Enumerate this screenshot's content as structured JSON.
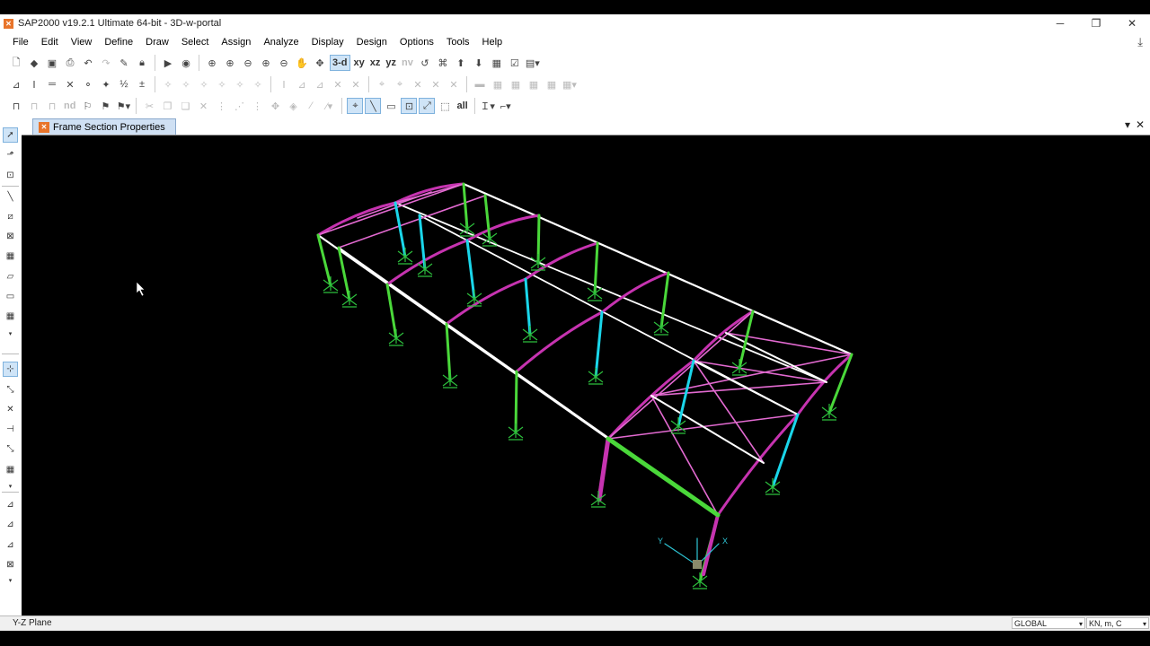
{
  "window": {
    "title": "SAP2000 v19.2.1 Ultimate 64-bit - 3D-w-portal",
    "icon": "app-logo-icon",
    "controls": [
      "minimize",
      "restore",
      "close"
    ]
  },
  "menu": [
    "File",
    "Edit",
    "View",
    "Define",
    "Draw",
    "Select",
    "Assign",
    "Analyze",
    "Display",
    "Design",
    "Options",
    "Tools",
    "Help"
  ],
  "toolbar": {
    "view_3d": "3-d",
    "view_xy": "xy",
    "view_xz": "xz",
    "view_yz": "yz",
    "view_nv": "nv",
    "show_nd": "nd",
    "grid_all": "all",
    "rows": [
      [
        "new-model",
        "open",
        "save",
        "print",
        "undo",
        "redo",
        "lock",
        "run",
        "run-analysis",
        "zoom-window",
        "zoom-in",
        "zoom-out",
        "zoom-fit",
        "zoom-prev",
        "pan",
        "rotate",
        "set-3d-view",
        "xy-view",
        "xz-view",
        "yz-view",
        "nv-view",
        "rotate-left",
        "perspective",
        "move-up",
        "move-down",
        "display-options",
        "check",
        "layout"
      ],
      [
        "frame-assign",
        "frame-release",
        "frame-local",
        "frame-offset",
        "joint-load",
        "restraint",
        "frame-loads",
        "area-loads",
        "shell",
        "wall",
        "deformed",
        "forces",
        "stresses",
        "animate",
        "section-props"
      ],
      [
        "draw-frame",
        "draw-cable",
        "draw-tendon",
        "select-pointer",
        "snap-points",
        "snap-ends",
        "snap-intersections",
        "reshape",
        "grid",
        "intersect",
        "divide",
        "merge",
        "extrude",
        "replicate",
        "toggle-snap",
        "quick-draw"
      ]
    ]
  },
  "tab": {
    "label": "Frame Section Properties",
    "icon": "frame-section-icon"
  },
  "status": {
    "left": "Y-Z Plane",
    "coord_system": "GLOBAL",
    "units": "KN, m, C"
  },
  "axes": {
    "x": "X",
    "y": "Y",
    "z": "Z"
  },
  "colors": {
    "beam_white": "#ffffff",
    "rafter_magenta": "#c633b0",
    "column_green": "#4ad83a",
    "column_cyan": "#1ad6ea",
    "support_green": "#2dbf3d",
    "brace_pink": "#e36ad1"
  }
}
